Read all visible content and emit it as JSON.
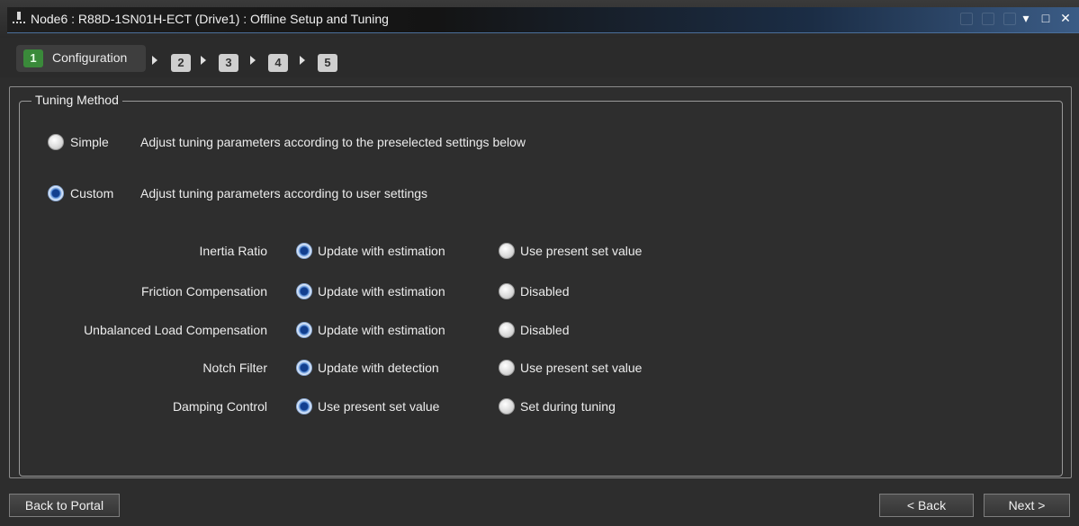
{
  "window": {
    "title": "Node6 : R88D-1SN01H-ECT (Drive1) : Offline Setup and Tuning",
    "minimize_glyph": "▾",
    "maximize_glyph": "□",
    "close_glyph": "✕"
  },
  "steps": [
    {
      "number": "1",
      "label": "Configuration",
      "active": true
    },
    {
      "number": "2"
    },
    {
      "number": "3"
    },
    {
      "number": "4"
    },
    {
      "number": "5"
    }
  ],
  "tuning_method": {
    "legend": "Tuning Method",
    "options": [
      {
        "label": "Simple",
        "description": "Adjust tuning parameters according to the preselected settings below",
        "selected": false
      },
      {
        "label": "Custom",
        "description": "Adjust tuning parameters according to user settings",
        "selected": true
      }
    ],
    "parameters": [
      {
        "label": "Inertia Ratio",
        "option_a": "Update with estimation",
        "option_b": "Use present set value",
        "selected": "a"
      },
      {
        "label": "Friction Compensation",
        "option_a": "Update with estimation",
        "option_b": "Disabled",
        "selected": "a"
      },
      {
        "label": "Unbalanced Load Compensation",
        "option_a": "Update with estimation",
        "option_b": "Disabled",
        "selected": "a"
      },
      {
        "label": "Notch Filter",
        "option_a": "Update with detection",
        "option_b": "Use present set value",
        "selected": "a"
      },
      {
        "label": "Damping Control",
        "option_a": "Use present set value",
        "option_b": "Set during tuning",
        "selected": "a"
      }
    ]
  },
  "footer": {
    "back_to_portal": "Back to Portal",
    "back": "< Back",
    "next": "Next >"
  }
}
